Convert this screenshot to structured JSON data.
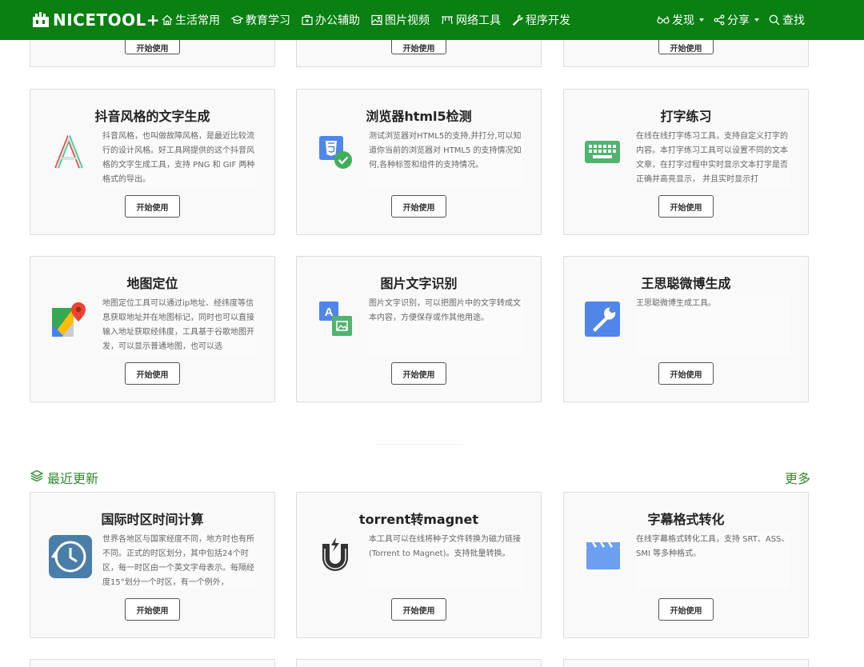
{
  "brand": {
    "name": "NICETOOL+"
  },
  "nav": {
    "main": [
      {
        "label": "生活常用",
        "icon": "home-icon"
      },
      {
        "label": "教育学习",
        "icon": "graduation-cap-icon"
      },
      {
        "label": "办公辅助",
        "icon": "briefcase-icon"
      },
      {
        "label": "图片视频",
        "icon": "image-icon"
      },
      {
        "label": "网络工具",
        "icon": "network-icon"
      },
      {
        "label": "程序开发",
        "icon": "wrench-icon"
      }
    ],
    "right": [
      {
        "label": "发现",
        "icon": "glasses-icon",
        "dropdown": true
      },
      {
        "label": "分享",
        "icon": "share-icon",
        "dropdown": true
      },
      {
        "label": "查找",
        "icon": "search-icon",
        "dropdown": false
      }
    ]
  },
  "start_label": "开始使用",
  "tools": [
    {
      "title": "抖音风格的文字生成",
      "icon": "glitch-letter-a-icon",
      "desc": "抖音风格，也叫做故障风格，是最近比较流行的设计风格。好工具网提供的这个抖音风格的文字生成工具，支持 PNG 和 GIF 两种格式的导出。"
    },
    {
      "title": "浏览器html5检测",
      "icon": "html5-check-icon",
      "desc": "测试浏览器对HTML5的支持,并打分,可以知道你当前的浏览器对 HTML5 的支持情况如何,各种标签和组件的支持情况。"
    },
    {
      "title": "打字练习",
      "icon": "keyboard-icon",
      "desc": "在线在线打字练习工具，支持自定义打字的内容。本打字练习工具可以设置不同的文本文章，在打字过程中实时显示文本打字是否正确并高亮显示， 并且实时显示打"
    },
    {
      "title": "地图定位",
      "icon": "map-pin-icon",
      "desc": "地图定位工具可以通过ip地址、经纬度等信息获取地址并在地图标记，同时也可以直接输入地址获取经纬度，工具基于谷歌地图开发，可以显示普通地图，也可以选"
    },
    {
      "title": "图片文字识别",
      "icon": "image-text-icon",
      "desc": "图片文字识别，可以把图片中的文字转成文本内容，方便保存或作其他用途。"
    },
    {
      "title": "王思聪微博生成",
      "icon": "wrench-icon",
      "desc": "王思聪微博生成工具。"
    }
  ],
  "recent": {
    "title": "最近更新",
    "icon": "layers-icon",
    "more": "更多",
    "tools": [
      {
        "title": "国际时区时间计算",
        "icon": "clock-icon",
        "desc": "世界各地区与国家经度不同，地方时也有所不同。正式的时区划分，其中包括24个时区，每一时区由一个英文字母表示。每隔经度15°划分一个时区，有一个例外，"
      },
      {
        "title": "torrent转magnet",
        "icon": "magnet-icon",
        "desc": "本工具可以在线将种子文件转换为磁力链接(Torrent to Magnet)。支持批量转换。"
      },
      {
        "title": "字幕格式转化",
        "icon": "clapperboard-icon",
        "desc": "在线字幕格式转化工具，支持 SRT、ASS、SMI 等多种格式。"
      }
    ]
  }
}
